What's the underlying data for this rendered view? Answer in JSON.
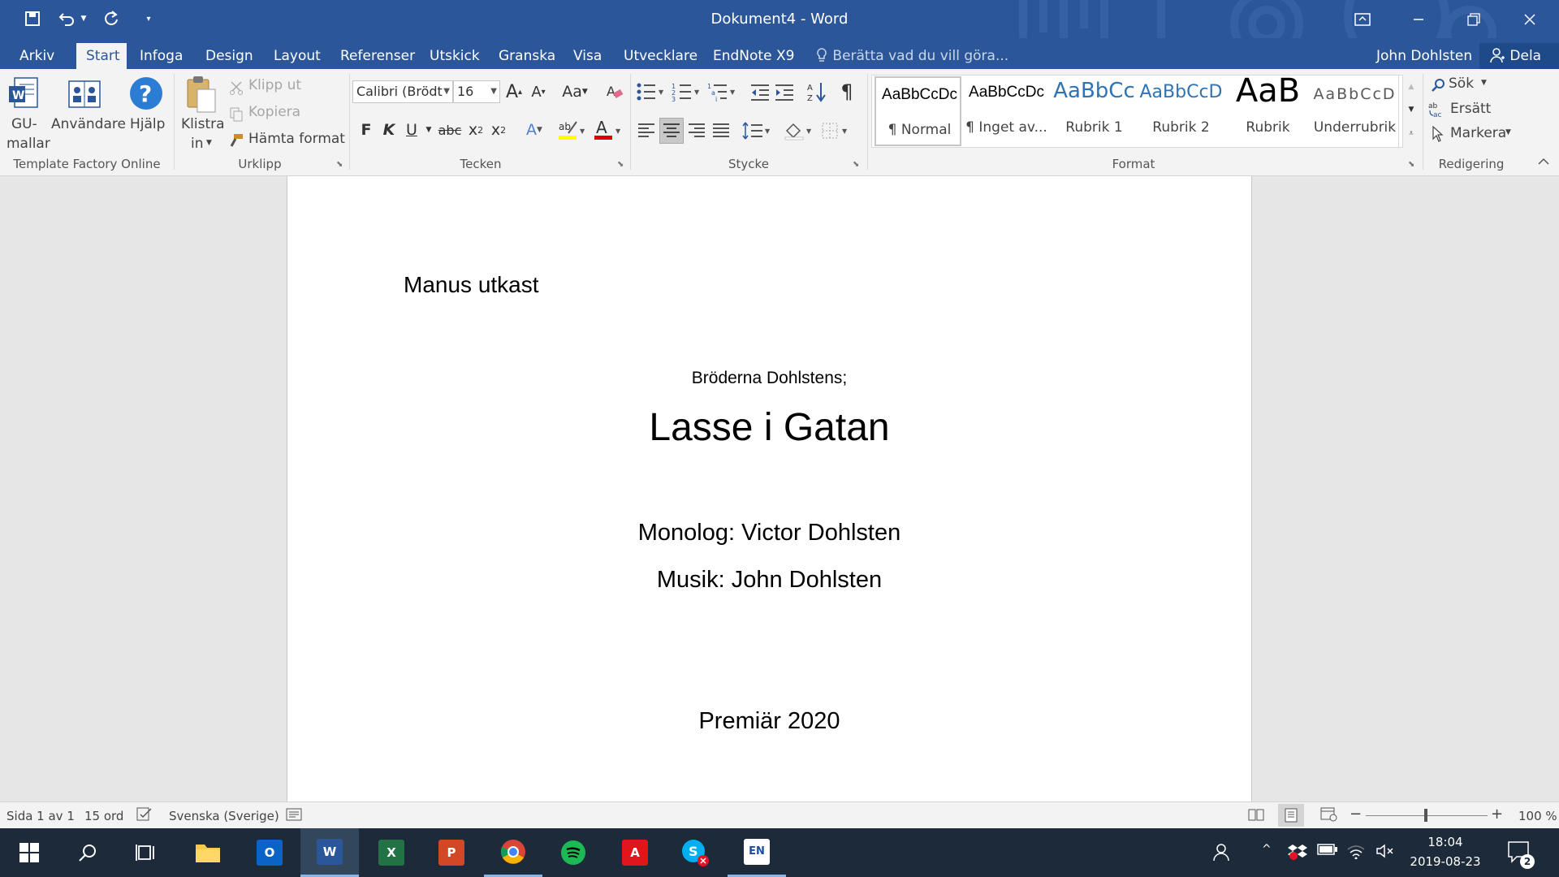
{
  "window": {
    "title": "Dokument4 - Word",
    "user": "John Dohlsten",
    "share_label": "Dela"
  },
  "tabs": [
    "Arkiv",
    "Start",
    "Infoga",
    "Design",
    "Layout",
    "Referenser",
    "Utskick",
    "Granska",
    "Visa",
    "Utvecklare",
    "EndNote X9"
  ],
  "active_tab": "Start",
  "tell_me": "Berätta vad du vill göra...",
  "ribbon": {
    "template_factory": {
      "btn1_line1": "GU-",
      "btn1_line2": "mallar",
      "btn2": "Användare",
      "btn3": "Hjälp",
      "group_label": "Template Factory Online"
    },
    "clipboard": {
      "paste_line1": "Klistra",
      "paste_line2": "in",
      "cut": "Klipp ut",
      "copy": "Kopiera",
      "format_painter": "Hämta format",
      "group_label": "Urklipp"
    },
    "font": {
      "font_name": "Calibri (Brödt",
      "font_size": "16",
      "change_case": "Aa",
      "bold": "F",
      "italic": "K",
      "underline": "U",
      "strike": "abc",
      "group_label": "Tecken"
    },
    "paragraph": {
      "group_label": "Stycke",
      "pilcrow": "¶"
    },
    "styles": {
      "items": [
        {
          "preview": "AaBbCcDc",
          "name": "¶ Normal"
        },
        {
          "preview": "AaBbCcDc",
          "name": "¶ Inget av..."
        },
        {
          "preview": "AaBbCc",
          "name": "Rubrik 1"
        },
        {
          "preview": "AaBbCcD",
          "name": "Rubrik 2"
        },
        {
          "preview": "AaB",
          "name": "Rubrik"
        },
        {
          "preview": "AaBbCcD",
          "name": "Underrubrik"
        }
      ],
      "group_label": "Format"
    },
    "editing": {
      "find": "Sök",
      "replace": "Ersätt",
      "select": "Markera",
      "group_label": "Redigering"
    }
  },
  "document": {
    "draft_label": "Manus utkast",
    "presenter": "Bröderna Dohlstens;",
    "title": "Lasse i Gatan",
    "monologue": "Monolog: Victor Dohlsten",
    "music": "Musik: John Dohlsten",
    "premiere": "Premiär 2020"
  },
  "status_bar": {
    "page": "Sida 1 av 1",
    "words": "15 ord",
    "language": "Svenska (Sverige)",
    "zoom": "100 %",
    "zoom_level": 1.0
  },
  "taskbar": {
    "apps": [
      "windows-start",
      "search",
      "task-view",
      "file-explorer",
      "outlook",
      "word",
      "excel",
      "powerpoint",
      "chrome",
      "spotify",
      "acrobat",
      "skype",
      "endnote"
    ],
    "time": "18:04",
    "date": "2019-08-23",
    "notifications": "2"
  },
  "colors": {
    "brand": "#2b579a",
    "ribbon_bg": "#f3f3f3",
    "taskbar": "#1c2a3a"
  }
}
